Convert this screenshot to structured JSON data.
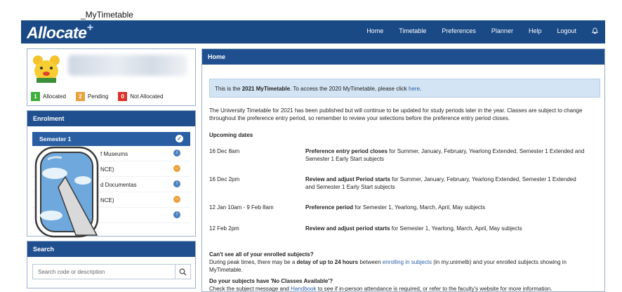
{
  "window_title": "_MyTimetable",
  "brand": {
    "logo": "Allocate",
    "logo_plus": "+"
  },
  "nav": [
    "Home",
    "Timetable",
    "Preferences",
    "Planner",
    "Help",
    "Logout"
  ],
  "legend": [
    {
      "num": "1",
      "label": "Allocated",
      "color": "#3fae3a"
    },
    {
      "num": "2",
      "label": "Pending",
      "color": "#e9a23b"
    },
    {
      "num": "0",
      "label": "Not Allocated",
      "color": "#d9342b"
    }
  ],
  "enrolment": {
    "title": "Enrolment",
    "semester": "Semester 1",
    "rows": [
      "f Museums",
      "NCE)",
      "d Documentas",
      "NCE)"
    ]
  },
  "search": {
    "title": "Search",
    "placeholder": "Search code or description"
  },
  "home": {
    "title": "Home",
    "notice_pre": "This is the ",
    "notice_bold": "2021 MyTimetable",
    "notice_mid": ". To access the 2020 MyTimetable, please click ",
    "notice_link": "here",
    "notice_end": ".",
    "intro": "The University Timetable for 2021 has been published but will continue to be updated for study periods later in the year. Classes are subject to change throughout the preference entry period, so remember to review your selections before the preference entry period closes.",
    "upcoming_title": "Upcoming dates",
    "dates": [
      {
        "date": "16 Dec 8am",
        "bold": "Preference entry period closes",
        "rest": " for Summer, January, February, Yearlong Extended, Semester 1 Extended and Semester 1 Early Start subjects"
      },
      {
        "date": "16 Dec 2pm",
        "bold": "Review and adjust Period starts",
        "rest": " for Summer, January, February, Yearlong Extended, Semester 1 Extended and Semester 1 Early Start subjects"
      },
      {
        "date": "12 Jan 10am - 9 Feb 8am",
        "bold": "Preference period",
        "rest": " for Semester 1, Yearlong, March, April, May subjects"
      },
      {
        "date": "12 Feb 2pm",
        "bold": "Review and adjust period starts",
        "rest": " for Semester 1, Yearlong, March, April, May subjects"
      }
    ],
    "q1_title": "Can't see all of your enrolled subjects?",
    "q1_pre": "During peak times, there may be a ",
    "q1_bold": "delay of up to 24 hours",
    "q1_mid": " between ",
    "q1_link": "enrolling in subjects",
    "q1_end": " (in my.unimelb) and your enrolled subjects showing in MyTimetable.",
    "q2_title": "Do your subjects have 'No Classes Available'?",
    "q2_pre": "Check the subject message and ",
    "q2_link": "Handbook",
    "q2_end": " to see if in-person attendance is required, or refer to the faculty's website for more information."
  }
}
